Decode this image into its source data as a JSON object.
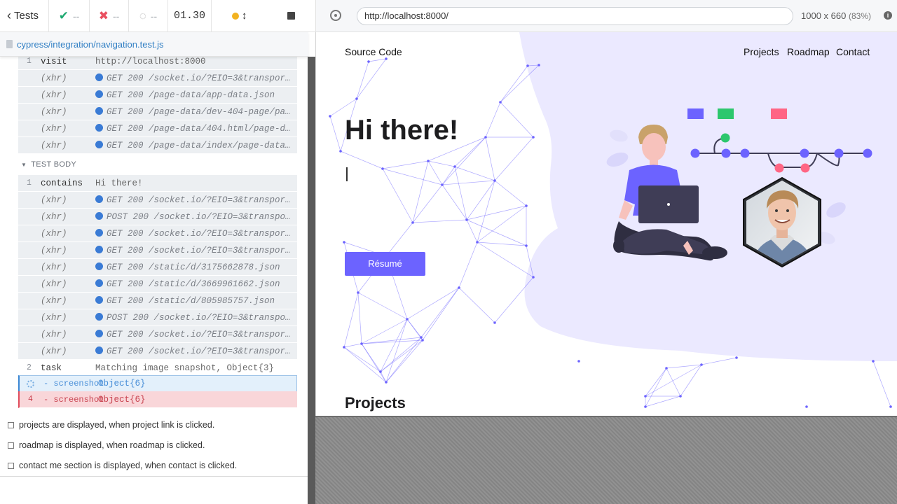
{
  "header": {
    "back_label": "Tests",
    "passed": "--",
    "failed": "--",
    "pending": "--",
    "timer": "01.30"
  },
  "spec": {
    "path": "cypress/integration/navigation.test.js"
  },
  "log": {
    "before_rows": [
      {
        "num": "1",
        "name": "visit",
        "msg": "http://localhost:8000",
        "xhr": false
      },
      {
        "num": "",
        "name": "(xhr)",
        "msg": "GET 200 /socket.io/?EIO=3&transport=…",
        "xhr": true
      },
      {
        "num": "",
        "name": "(xhr)",
        "msg": "GET 200 /page-data/app-data.json",
        "xhr": true
      },
      {
        "num": "",
        "name": "(xhr)",
        "msg": "GET 200 /page-data/dev-404-page/page…",
        "xhr": true
      },
      {
        "num": "",
        "name": "(xhr)",
        "msg": "GET 200 /page-data/404.html/page-dat…",
        "xhr": true
      },
      {
        "num": "",
        "name": "(xhr)",
        "msg": "GET 200 /page-data/index/page-data.j…",
        "xhr": true
      }
    ],
    "section_title": "TEST BODY",
    "body_rows": [
      {
        "num": "1",
        "name": "contains",
        "msg": "Hi there!",
        "xhr": false
      },
      {
        "num": "",
        "name": "(xhr)",
        "msg": "GET 200 /socket.io/?EIO=3&transport=…",
        "xhr": true
      },
      {
        "num": "",
        "name": "(xhr)",
        "msg": "POST 200 /socket.io/?EIO=3&transport…",
        "xhr": true
      },
      {
        "num": "",
        "name": "(xhr)",
        "msg": "GET 200 /socket.io/?EIO=3&transport=…",
        "xhr": true
      },
      {
        "num": "",
        "name": "(xhr)",
        "msg": "GET 200 /socket.io/?EIO=3&transport=…",
        "xhr": true
      },
      {
        "num": "",
        "name": "(xhr)",
        "msg": "GET 200 /static/d/3175662878.json",
        "xhr": true
      },
      {
        "num": "",
        "name": "(xhr)",
        "msg": "GET 200 /static/d/3669961662.json",
        "xhr": true
      },
      {
        "num": "",
        "name": "(xhr)",
        "msg": "GET 200 /static/d/805985757.json",
        "xhr": true
      },
      {
        "num": "",
        "name": "(xhr)",
        "msg": "POST 200 /socket.io/?EIO=3&transport…",
        "xhr": true
      },
      {
        "num": "",
        "name": "(xhr)",
        "msg": "GET 200 /socket.io/?EIO=3&transport=…",
        "xhr": true
      },
      {
        "num": "",
        "name": "(xhr)",
        "msg": "GET 200 /socket.io/?EIO=3&transport=…",
        "xhr": true
      },
      {
        "num": "2",
        "name": "task",
        "msg": "Matching image snapshot, Object{3}",
        "xhr": false
      }
    ],
    "active_row": {
      "name": "- screenshot",
      "msg": "Object{6}"
    },
    "failed_row": {
      "num": "4",
      "name": "- screenshot",
      "msg": "Object{6}"
    }
  },
  "tests": [
    "projects are displayed, when project link is clicked.",
    "roadmap is displayed, when roadmap is clicked.",
    "contact me section is displayed, when contact is clicked."
  ],
  "aut": {
    "url": "http://localhost:8000/",
    "viewport": "1000 x 660",
    "zoom": "(83%)"
  },
  "site": {
    "source_link": "Source Code",
    "nav": [
      "Projects",
      "Roadmap",
      "Contact"
    ],
    "hero_title": "Hi there!",
    "resume_button": "Résumé",
    "projects_heading": "Projects",
    "accent_color": "#6c63ff",
    "blob_color": "#ebe9ff"
  }
}
